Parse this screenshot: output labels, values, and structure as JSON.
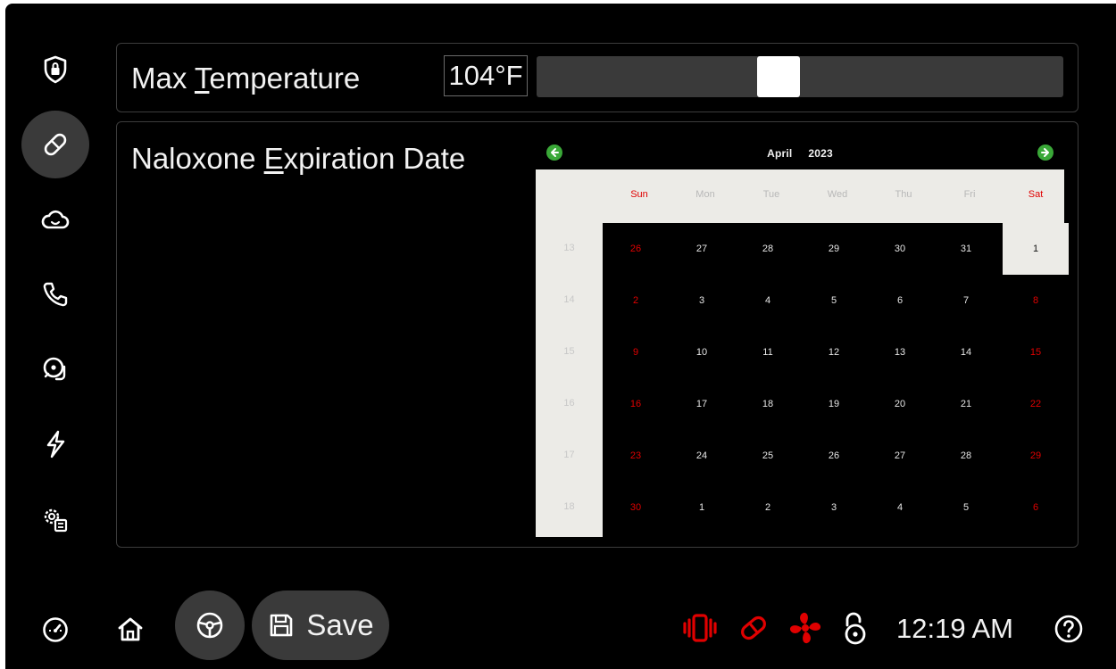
{
  "settings": {
    "max_temperature": {
      "label_prefix": "Max ",
      "label_hotkey": "T",
      "label_suffix": "emperature",
      "value": "104°F",
      "slider_fraction": 0.46
    },
    "naloxone": {
      "label_prefix": "Naloxone ",
      "label_hotkey": "E",
      "label_suffix": "xpiration Date"
    }
  },
  "calendar": {
    "month": "April",
    "year": "2023",
    "weekdays": [
      "Sun",
      "Mon",
      "Tue",
      "Wed",
      "Thu",
      "Fri",
      "Sat"
    ],
    "week_numbers": [
      "13",
      "14",
      "15",
      "16",
      "17",
      "18"
    ],
    "weeks": [
      [
        "26",
        "27",
        "28",
        "29",
        "30",
        "31",
        "1"
      ],
      [
        "2",
        "3",
        "4",
        "5",
        "6",
        "7",
        "8"
      ],
      [
        "9",
        "10",
        "11",
        "12",
        "13",
        "14",
        "15"
      ],
      [
        "16",
        "17",
        "18",
        "19",
        "20",
        "21",
        "22"
      ],
      [
        "23",
        "24",
        "25",
        "26",
        "27",
        "28",
        "29"
      ],
      [
        "30",
        "1",
        "2",
        "3",
        "4",
        "5",
        "6"
      ]
    ],
    "selected": "1",
    "weekend_color": "#e00000",
    "nav_color": "#3aa838"
  },
  "sidebar": {
    "items": [
      {
        "icon": "shield-lock-icon",
        "active": false
      },
      {
        "icon": "pill-icon",
        "active": true
      },
      {
        "icon": "cloud-icon",
        "active": false
      },
      {
        "icon": "phone-icon",
        "active": false
      },
      {
        "icon": "alarm-bell-icon",
        "active": false
      },
      {
        "icon": "lightning-icon",
        "active": false
      },
      {
        "icon": "settings-gears-icon",
        "active": false
      }
    ]
  },
  "bottom_bar": {
    "save_label": "Save",
    "time": "12:19 AM",
    "status_icons": [
      "vibration-icon",
      "pill-status-icon",
      "fan-icon",
      "unlock-icon"
    ],
    "alert_color": "#e00000"
  }
}
